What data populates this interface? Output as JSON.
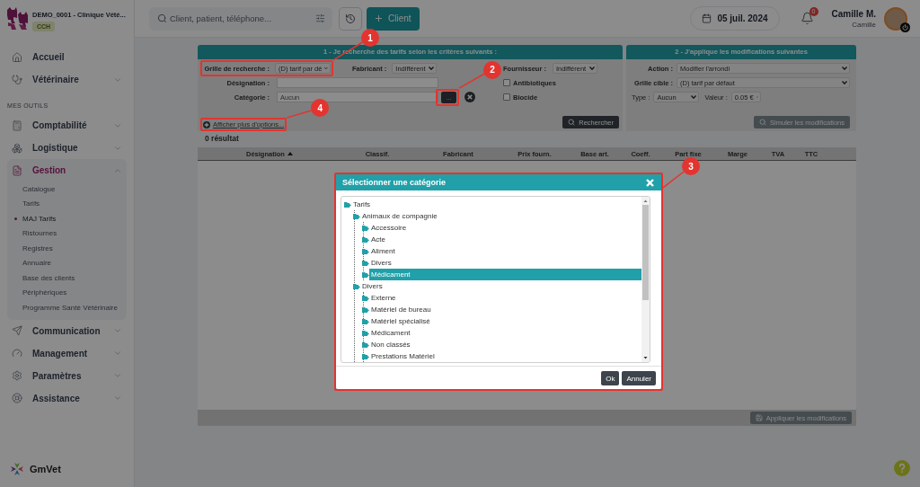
{
  "sidebar": {
    "clinic_name": "DEMO_0001 - Clinique Vété...",
    "clinic_badge": "CCH",
    "nav": [
      {
        "kind": "item",
        "label": "Accueil",
        "selected": false
      },
      {
        "kind": "item",
        "label": "Vétérinaire",
        "selected": false,
        "expanded": false
      },
      {
        "kind": "section",
        "label": "MES OUTILS"
      },
      {
        "kind": "item",
        "label": "Comptabilité",
        "selected": false,
        "expanded": false
      },
      {
        "kind": "item",
        "label": "Logistique",
        "selected": false,
        "expanded": false
      },
      {
        "kind": "item",
        "label": "Gestion",
        "selected": true,
        "expanded": true,
        "children": [
          {
            "label": "Catalogue",
            "selected": false
          },
          {
            "label": "Tarifs",
            "selected": false
          },
          {
            "label": "MAJ Tarifs",
            "selected": true
          },
          {
            "label": "Ristournes",
            "selected": false
          },
          {
            "label": "Registres",
            "selected": false
          },
          {
            "label": "Annuaire",
            "selected": false
          },
          {
            "label": "Base des clients",
            "selected": false
          },
          {
            "label": "Périphériques",
            "selected": false
          },
          {
            "label": "Programme Santé Vétérinaire",
            "selected": false
          }
        ]
      },
      {
        "kind": "item",
        "label": "Communication",
        "selected": false,
        "expanded": false
      },
      {
        "kind": "item",
        "label": "Management",
        "selected": false,
        "expanded": false
      },
      {
        "kind": "item",
        "label": "Paramètres",
        "selected": false,
        "expanded": false
      },
      {
        "kind": "item",
        "label": "Assistance",
        "selected": false,
        "expanded": false
      }
    ],
    "brand": "GmVet"
  },
  "topbar": {
    "search": {
      "placeholder": "Client, patient, téléphone..."
    },
    "new_client_button": "Client",
    "date": "05 juil. 2024",
    "notification_count": "0",
    "user": {
      "name": "Camille M.",
      "subtitle": "Camille"
    }
  },
  "search_panel": {
    "title": "1 - Je recherche des tarifs selon les critères suivants :",
    "grid": {
      "label": "Grille de recherche :",
      "value": "(D) tarif par dé"
    },
    "manufacturer": {
      "label": "Fabricant :",
      "value": "Indifférent"
    },
    "supplier": {
      "label": "Fournisseur :",
      "value": "Indifférent"
    },
    "designation": {
      "label": "Désignation :"
    },
    "category": {
      "label": "Catégorie :",
      "value": "Aucun",
      "browse_button": "..."
    },
    "checkboxes": [
      {
        "label": "Antibiotiques",
        "checked": false
      },
      {
        "label": "Biocide",
        "checked": false
      }
    ],
    "more_options_link": "Afficher plus d'options...",
    "search_button": {
      "label": "Rechercher",
      "disabled": false
    }
  },
  "modify_panel": {
    "title": "2 - J'applique les modifications suivantes",
    "action": {
      "label": "Action :",
      "value": "Modifier l'arrondi"
    },
    "target_grid": {
      "label": "Grille cible :",
      "value": "(D) tarif par défaut"
    },
    "type": {
      "label": "Type :",
      "value": "Aucun"
    },
    "amount": {
      "label": "Valeur :",
      "value": "0.05 €"
    },
    "simulate_button": {
      "label": "Simuler les modifications",
      "disabled": true
    }
  },
  "results": {
    "count": "0 résultat",
    "columns": [
      {
        "label": "Désignation",
        "sorted": true
      },
      {
        "label": "Classif.",
        "sorted": false
      },
      {
        "label": "Fabricant",
        "sorted": false
      },
      {
        "label": "Prix fourn.",
        "sorted": false
      },
      {
        "label": "Base art.",
        "sorted": false
      },
      {
        "label": "Coeff.",
        "sorted": false
      },
      {
        "label": "Part fixe",
        "sorted": false
      },
      {
        "label": "Marge",
        "sorted": false
      },
      {
        "label": "TVA",
        "sorted": false
      },
      {
        "label": "TTC",
        "sorted": false
      }
    ],
    "apply_button": {
      "label": "Appliquer les modifications",
      "disabled": true
    }
  },
  "dialog": {
    "title": "Sélectionner une catégorie",
    "tree": [
      {
        "label": "Tarifs",
        "selected": false,
        "children": [
          {
            "label": "Animaux de compagnie",
            "selected": false,
            "children": [
              {
                "label": "Accessoire",
                "selected": false
              },
              {
                "label": "Acte",
                "selected": false
              },
              {
                "label": "Aliment",
                "selected": false
              },
              {
                "label": "Divers",
                "selected": false
              },
              {
                "label": "Médicament",
                "selected": true
              }
            ]
          },
          {
            "label": "Divers",
            "selected": false,
            "children": [
              {
                "label": "Externe",
                "selected": false
              },
              {
                "label": "Matériel de bureau",
                "selected": false
              },
              {
                "label": "Matériel spécialisé",
                "selected": false
              },
              {
                "label": "Médicament",
                "selected": false
              },
              {
                "label": "Non classés",
                "selected": false
              },
              {
                "label": "Prestations Matériel",
                "selected": false
              }
            ]
          }
        ]
      }
    ],
    "buttons": [
      "Ok",
      "Annuler"
    ]
  },
  "annotations": [
    {
      "number": "1"
    },
    {
      "number": "2"
    },
    {
      "number": "3"
    },
    {
      "number": "4"
    }
  ]
}
